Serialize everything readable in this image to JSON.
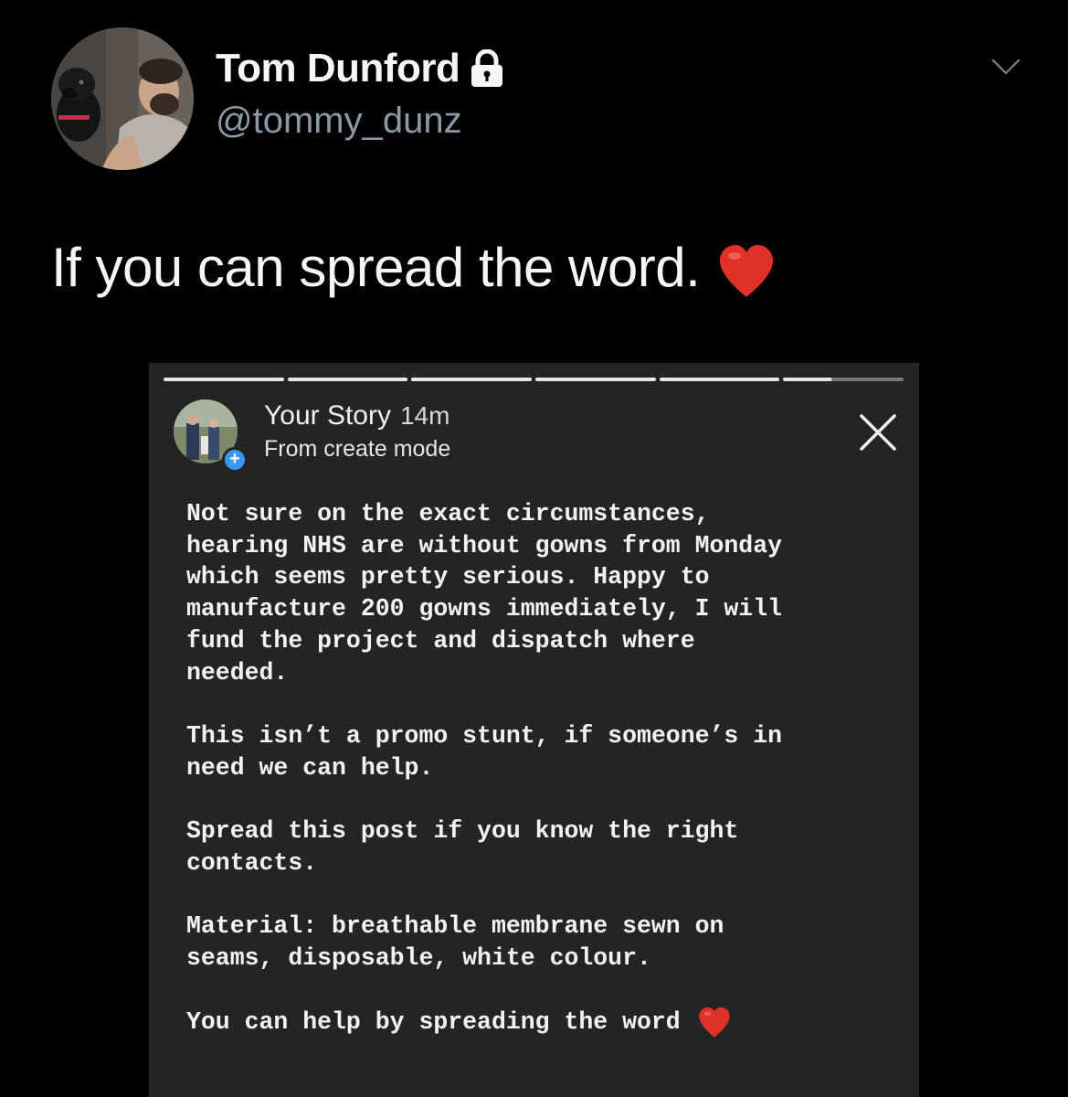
{
  "author": {
    "name": "Tom Dunford",
    "handle": "@tommy_dunz"
  },
  "tweet": {
    "text": "If you can spread the word."
  },
  "story": {
    "title": "Your Story",
    "time": "14m",
    "subtitle": "From create mode",
    "add_badge": "+",
    "paragraphs": [
      "Not sure on the exact circumstances,\nhearing NHS are without gowns from Monday\nwhich seems pretty serious. Happy to\nmanufacture 200 gowns immediately, I will\nfund the project and dispatch where\nneeded.",
      "This isn’t a promo stunt, if someone’s in\nneed we can help.",
      "Spread this post if you know the right\ncontacts.",
      "Material: breathable membrane sewn on\nseams, disposable, white colour."
    ],
    "last_line": "You can help by spreading the word"
  },
  "icons": {
    "lock": "lock-icon",
    "chevron": "chevron-down-icon",
    "heart": "heart-icon",
    "close": "close-icon"
  },
  "colors": {
    "background": "#000000",
    "handle": "#8b98a5",
    "heart": "#e0302a",
    "story_bg": "#242424",
    "badge": "#3897f0"
  }
}
